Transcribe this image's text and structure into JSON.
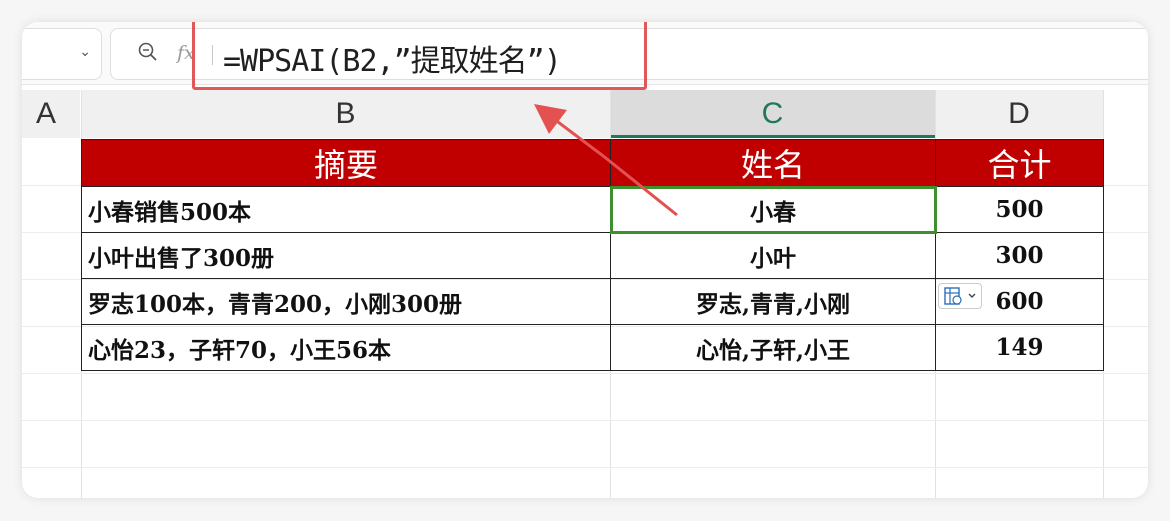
{
  "formula": {
    "fx_label": "fx",
    "text": "=WPSAI(B2,”提取姓名”)"
  },
  "columns": [
    "A",
    "B",
    "C",
    "D"
  ],
  "table": {
    "headers": [
      "摘要",
      "姓名",
      "合计"
    ],
    "rows": [
      [
        "小春销售500本",
        "小春",
        "500"
      ],
      [
        "小叶出售了300册",
        "小叶",
        "300"
      ],
      [
        "罗志100本，青青200，小刚300册",
        "罗志,青青,小刚",
        "600"
      ],
      [
        "心怡23，子轩70，小王56本",
        "心怡,子轩,小王",
        "149"
      ]
    ]
  },
  "colors": {
    "header_bg": "#c00000",
    "selection": "#3e8f2f",
    "highlight": "#e15858"
  },
  "icons": [
    "chevron-down-icon",
    "zoom-icon",
    "paste-options-icon",
    "arrow-annotation-icon"
  ]
}
